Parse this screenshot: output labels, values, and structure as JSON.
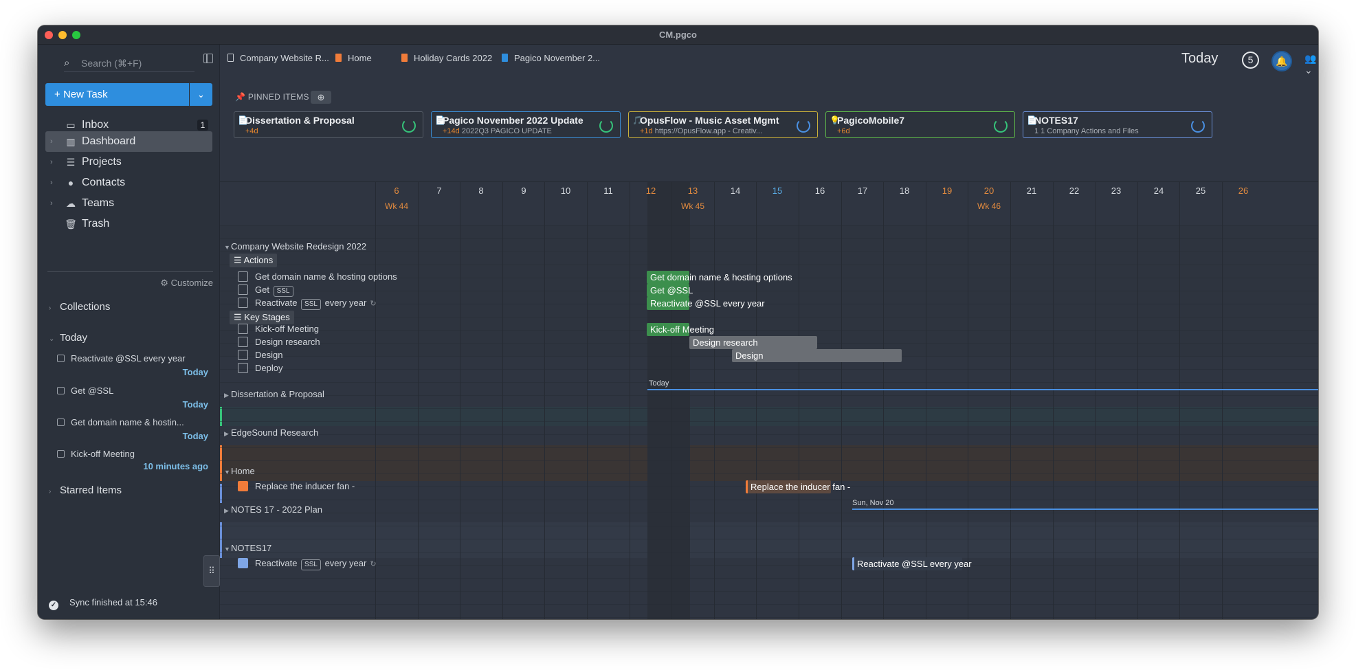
{
  "window": {
    "title": "CM.pgco"
  },
  "sidebar": {
    "search_placeholder": "Search (⌘+F)",
    "new_task": "New Task",
    "nav": [
      {
        "label": "Inbox",
        "icon": "inbox-icon",
        "badge": "1"
      },
      {
        "label": "Dashboard",
        "icon": "chart-icon"
      },
      {
        "label": "Projects",
        "icon": "list-icon"
      },
      {
        "label": "Contacts",
        "icon": "person-icon"
      },
      {
        "label": "Teams",
        "icon": "cloud-icon"
      },
      {
        "label": "Trash",
        "icon": "trash-icon"
      }
    ],
    "customize": "Customize",
    "collections": "Collections",
    "today_section": "Today",
    "today_items": [
      {
        "text": "Reactivate @SSL every year",
        "when": "Today"
      },
      {
        "text": "Get @SSL",
        "when": "Today"
      },
      {
        "text": "Get domain name & hostin...",
        "when": "Today"
      },
      {
        "text": "Kick-off Meeting",
        "when": "10 minutes ago"
      }
    ],
    "starred": "Starred Items",
    "sync": "Sync finished at 15:46"
  },
  "tabs": [
    {
      "label": "Company Website R...",
      "icon": "document-icon"
    },
    {
      "label": "Home",
      "icon": "orange-doc-icon"
    },
    {
      "label": "Holiday Cards 2022",
      "icon": "orange-doc-icon"
    },
    {
      "label": "Pagico November 2...",
      "icon": "blue-doc-icon"
    }
  ],
  "header": {
    "today_label": "Today",
    "today_count": "5"
  },
  "pinned": {
    "label": "PINNED ITEMS",
    "cards": [
      {
        "title": "Dissertation & Proposal",
        "warn": "+4d",
        "meta": "",
        "border": "#555c67",
        "ring": "#36c37a"
      },
      {
        "title": "Pagico November 2022 Update",
        "warn": "+14d",
        "meta": "2022Q3  PAGICO  UPDATE",
        "border": "#3b8ed6",
        "ring": "#36c37a"
      },
      {
        "title": "OpusFlow - Music Asset Mgmt",
        "warn": "+1d",
        "meta": "https://OpusFlow.app - Creativ...",
        "border": "#c9b03a",
        "ring": "#4a90e2"
      },
      {
        "title": "PagicoMobile7",
        "warn": "+6d",
        "meta": "",
        "border": "#5fb84a",
        "ring": "#36c37a"
      },
      {
        "title": "NOTES17",
        "warn": "",
        "meta": "1   1   Company Actions and Files",
        "border": "#6a8fd8",
        "ring": "#4a90e2"
      }
    ]
  },
  "timeline": {
    "days": [
      "6",
      "7",
      "8",
      "9",
      "10",
      "11",
      "12",
      "13",
      "14",
      "15",
      "16",
      "17",
      "18",
      "19",
      "20",
      "21",
      "22",
      "23",
      "24",
      "25",
      "26"
    ],
    "weekend_days": [
      "6",
      "12",
      "13",
      "19",
      "20",
      "26"
    ],
    "today_day": "15",
    "weeks": [
      "Wk 44",
      "Wk 45",
      "Wk 46"
    ],
    "groups": {
      "company": "Company Website Redesign 2022",
      "actions": "Actions",
      "key_stages": "Key Stages",
      "dissertation": "Dissertation & Proposal",
      "edgesound": "EdgeSound Research",
      "home": "Home",
      "notes_plan": "NOTES 17 - 2022 Plan",
      "notes17": "NOTES17"
    },
    "tasks": {
      "get_domain": "Get domain name & hosting options",
      "get_ssl_pre": "Get",
      "ssl_tag": "SSL",
      "reactivate_pre": "Reactivate",
      "reactivate_post": "every year",
      "kickoff": "Kick-off Meeting",
      "design_research": "Design research",
      "design": "Design",
      "deploy": "Deploy",
      "replace_fan": "Replace the inducer fan -"
    },
    "bars": {
      "get_domain": "Get domain name & hosting options",
      "get_ssl": "Get @SSL",
      "reactivate": "Reactivate @SSL every year",
      "kickoff": "Kick-off Meeting",
      "design_research": "Design research",
      "design": "Design",
      "replace_fan": "Replace the inducer fan -",
      "notes_reactivate": "Reactivate @SSL every year"
    },
    "markers": {
      "today": "Today",
      "sun_nov20": "Sun, Nov 20"
    }
  }
}
